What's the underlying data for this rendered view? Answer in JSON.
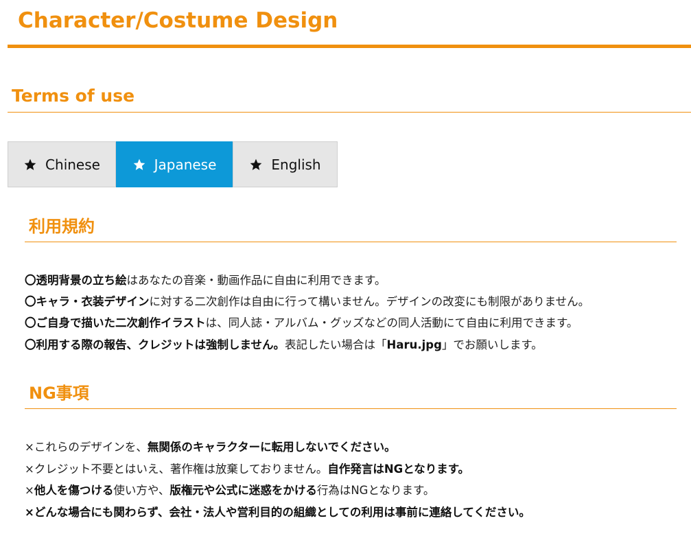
{
  "header": {
    "title": "Character/Costume Design"
  },
  "section": {
    "title": "Terms of use"
  },
  "tabs": [
    {
      "label": "Chinese",
      "icon": "star-icon",
      "active": false
    },
    {
      "label": "Japanese",
      "icon": "star-icon",
      "active": true
    },
    {
      "label": "English",
      "icon": "star-icon",
      "active": false
    }
  ],
  "terms": {
    "heading": "利用規約",
    "lines": [
      [
        {
          "text": "〇透明背景の立ち絵",
          "bold": true
        },
        {
          "text": "はあなたの音楽・動画作品に自由に利用できます。",
          "bold": false
        }
      ],
      [
        {
          "text": "〇キャラ・衣装デザイン",
          "bold": true
        },
        {
          "text": "に対する二次創作は自由に行って構いません。デザインの改変にも制限がありません。",
          "bold": false
        }
      ],
      [
        {
          "text": "〇ご自身で描いた二次創作イラスト",
          "bold": true
        },
        {
          "text": "は、同人誌・アルバム・グッズなどの同人活動にて自由に利用できます。",
          "bold": false
        }
      ],
      [
        {
          "text": "〇利用する際の報告、クレジットは強制しません。",
          "bold": true
        },
        {
          "text": "表記したい場合は「",
          "bold": false
        },
        {
          "text": "Haru.jpg",
          "bold": true
        },
        {
          "text": "」でお願いします。",
          "bold": false
        }
      ]
    ]
  },
  "ng": {
    "heading": "NG事項",
    "lines": [
      [
        {
          "text": "×これらのデザインを、",
          "bold": false
        },
        {
          "text": "無関係のキャラクターに転用しないでください。",
          "bold": true
        }
      ],
      [
        {
          "text": "×クレジット不要とはいえ、著作権は放棄しておりません。",
          "bold": false
        },
        {
          "text": "自作発言はNGとなります。",
          "bold": true
        }
      ],
      [
        {
          "text": "×",
          "bold": false
        },
        {
          "text": "他人を傷つける",
          "bold": true
        },
        {
          "text": "使い方や、",
          "bold": false
        },
        {
          "text": "版権元や公式に迷惑をかける",
          "bold": true
        },
        {
          "text": "行為はNGとなります。",
          "bold": false
        }
      ],
      [
        {
          "text": "×どんな場合にも関わらず、会社・法人や営利目的の組織としての利用は事前に連絡してください。",
          "bold": true
        }
      ]
    ]
  },
  "colors": {
    "accent": "#f0900f",
    "tab_active": "#0d99d8",
    "tab_inactive": "#e6e6e6"
  }
}
